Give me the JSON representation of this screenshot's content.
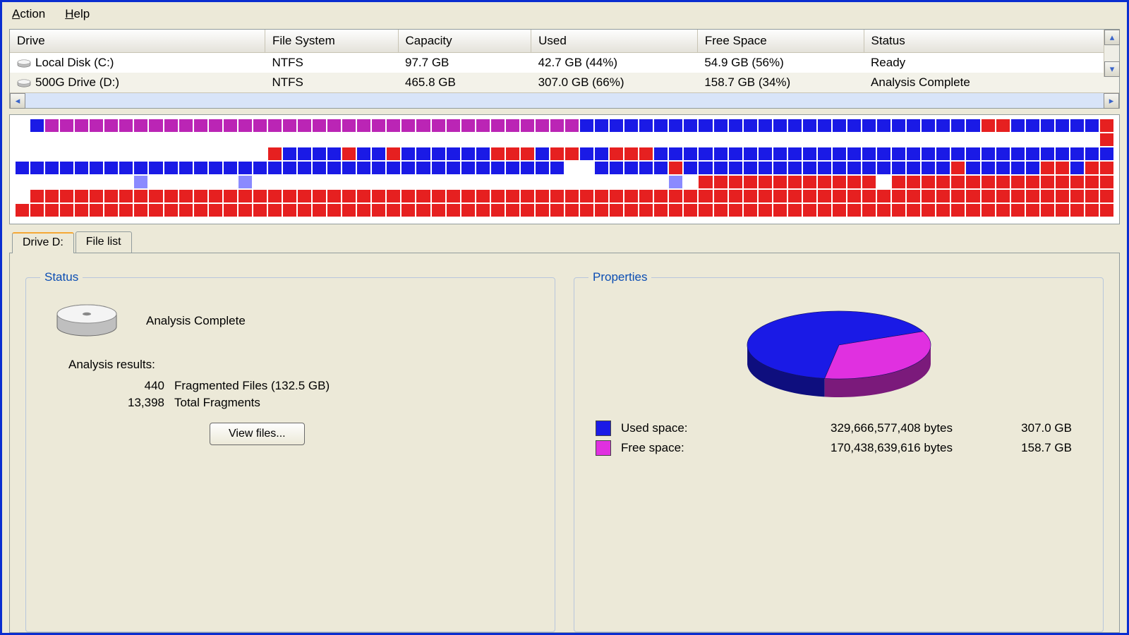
{
  "menubar": {
    "action": "Action",
    "action_u": "A",
    "help": "Help",
    "help_u": "H"
  },
  "driveTable": {
    "headers": {
      "drive": "Drive",
      "fs": "File System",
      "capacity": "Capacity",
      "used": "Used",
      "free": "Free Space",
      "status": "Status"
    },
    "rows": [
      {
        "drive": "Local Disk (C:)",
        "fs": "NTFS",
        "capacity": "97.7 GB",
        "used": "42.7 GB (44%)",
        "free": "54.9 GB (56%)",
        "status": "Ready"
      },
      {
        "drive": "500G Drive (D:)",
        "fs": "NTFS",
        "capacity": "465.8 GB",
        "used": "307.0 GB (66%)",
        "free": "158.7 GB (34%)",
        "status": "Analysis Complete"
      }
    ]
  },
  "fragmap": {
    "cols": 74,
    "rows": [
      "ebmmmmmmmmmmmmmmmmmmmmmmmmmmmmmmmmmmmmbbbbbbbbbbbbbbbbbbbbbbbbbbbrrbbbbbbr",
      "eeeeeeeeeeeeeeeeeeeeeeeeeeeeeeeeeeeeeeeeeeeeeeeeeeeeeeeeeeeeeeeeeeeeeeeeer",
      "eeeeeeeeeeeeeeeeerbbbbrbbrbbbbbbrrrbrrbbrrrbbbbbbbbbbbbbbbbbbbbbbbbbbbbbbb",
      "bbbbbbbbbbbbbbbbbbbbbbbbbbbbbbbbbbbbbeebbbbbrbbbbbbbbbbbbbbbbbbrbbbbbrrbrr",
      "eeeeeeeeleeeeeeleeeeeeeeeeeeeeeeeeeeeeeeeeeelerrrrrrrrrrrrerrrrrrrrrrrrrrr",
      "errrrrrrrrrrrrrrrrrrrrrrrrrrrrrrrrrrrrrrrrrrrrrrrrrrrrrrrrrrrrrrrrrrrrrrrr",
      "rrrrrrrrrrrrrrrrrrrrrrrrrrrrrrrrrrrrrrrrrrrrrrrrrrrrrrrrrrrrrrrrrrrrrrrrrr"
    ]
  },
  "tabs": {
    "drive": "Drive D:",
    "filelist": "File list"
  },
  "status": {
    "legend": "Status",
    "line": "Analysis Complete",
    "resultsHeading": "Analysis results:",
    "fragFilesCount": "440",
    "fragFilesLabel": "Fragmented Files (132.5 GB)",
    "totalFragCount": "13,398",
    "totalFragLabel": "Total Fragments",
    "viewFiles": "View files..."
  },
  "props": {
    "legend": "Properties",
    "used": {
      "label": "Used space:",
      "bytes": "329,666,577,408  bytes",
      "gb": "307.0 GB"
    },
    "free": {
      "label": "Free space:",
      "bytes": "170,438,639,616  bytes",
      "gb": "158.7 GB"
    }
  },
  "chart_data": {
    "type": "pie",
    "title": "",
    "series": [
      {
        "name": "Used space",
        "value": 307.0,
        "unit": "GB",
        "color": "#1a1ae6"
      },
      {
        "name": "Free space",
        "value": 158.7,
        "unit": "GB",
        "color": "#e030e0"
      }
    ]
  }
}
